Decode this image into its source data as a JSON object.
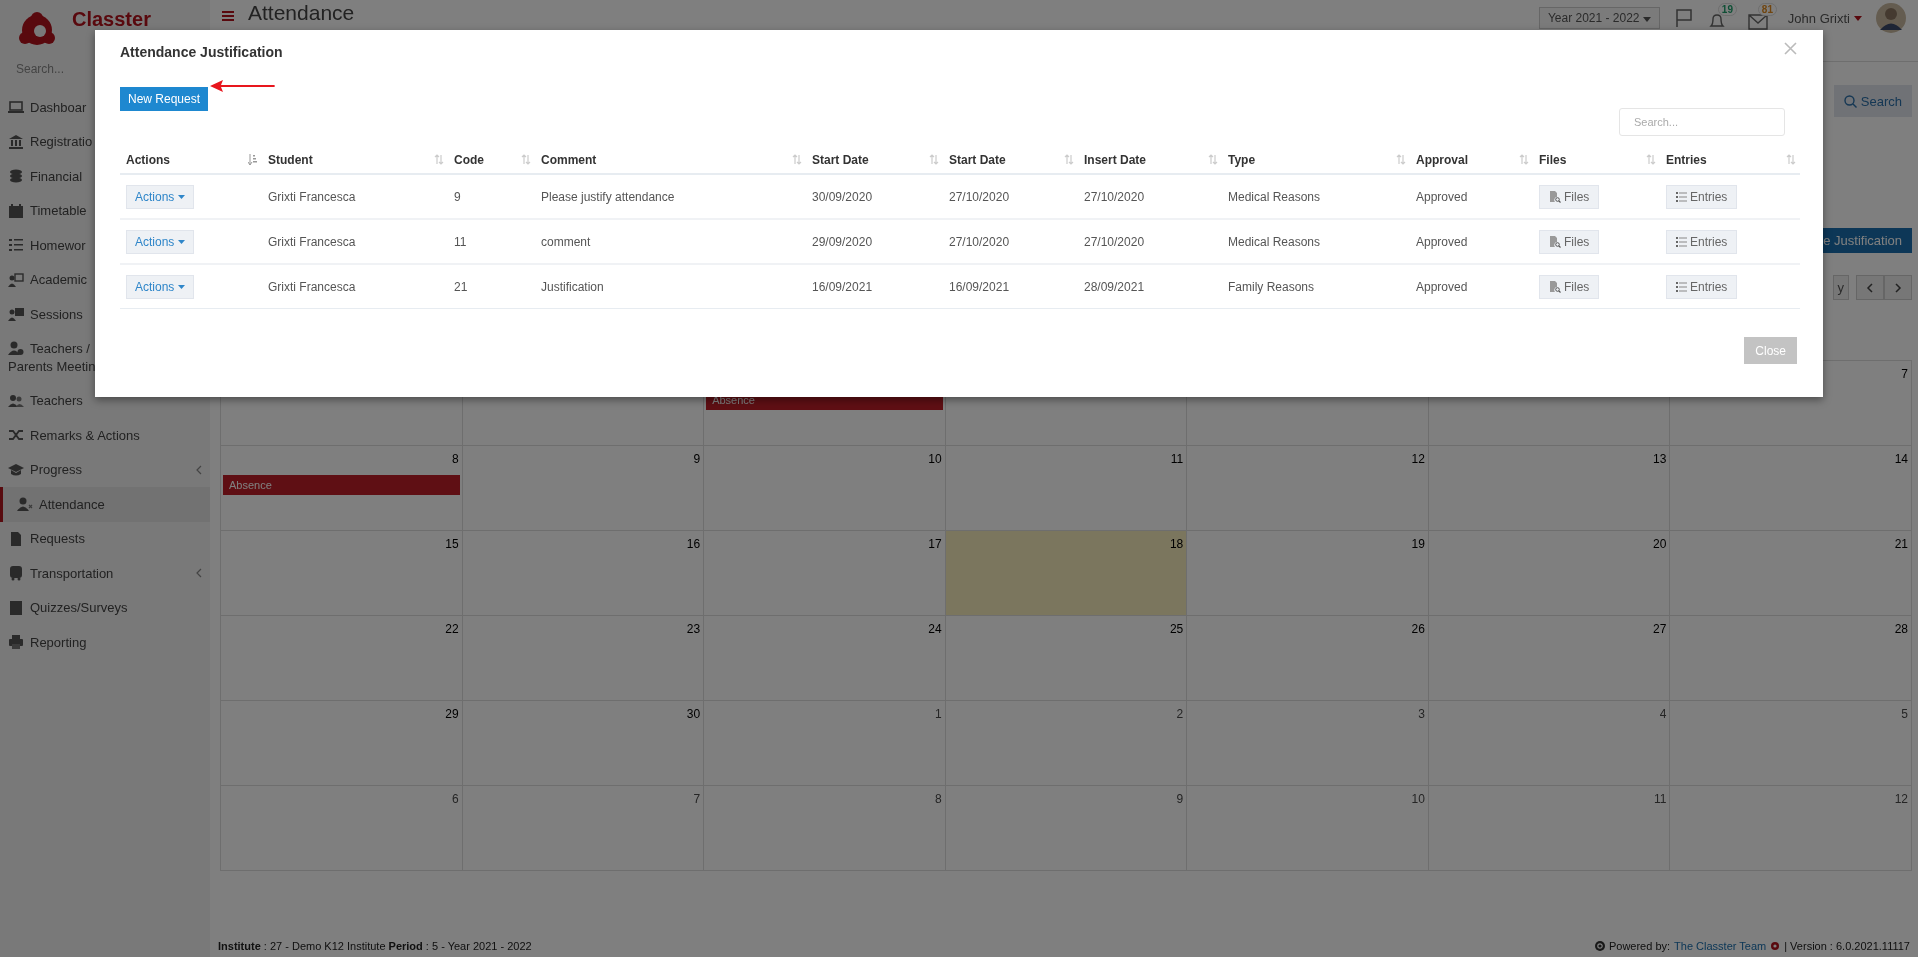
{
  "sidebar": {
    "logo": "Classter",
    "search_placeholder": "Search...",
    "items": [
      {
        "label": "Dashboar",
        "selected": false
      },
      {
        "label": "Registratio",
        "selected": false
      },
      {
        "label": "Financial",
        "selected": false
      },
      {
        "label": "Timetable",
        "selected": false
      },
      {
        "label": "Homewor",
        "selected": false
      },
      {
        "label": "Academic",
        "selected": false
      },
      {
        "label": "Sessions",
        "selected": false
      },
      {
        "label": "Teachers /\nParents Meetin",
        "selected": false
      },
      {
        "label": "Teachers",
        "selected": false,
        "submenu": false
      },
      {
        "label": "Remarks & Actions",
        "selected": false,
        "submenu": false
      },
      {
        "label": "Progress",
        "selected": false,
        "submenu": true
      },
      {
        "label": "Attendance",
        "selected": true,
        "submenu": false
      },
      {
        "label": "Requests",
        "selected": false,
        "submenu": false
      },
      {
        "label": "Transportation",
        "selected": false,
        "submenu": true
      },
      {
        "label": "Quizzes/Surveys",
        "selected": false,
        "submenu": false
      },
      {
        "label": "Reporting",
        "selected": false,
        "submenu": false
      }
    ]
  },
  "header": {
    "title": "Attendance",
    "year": "Year 2021 - 2022",
    "notifications": "19",
    "messages": "81",
    "user": "John Grixti"
  },
  "filters": {
    "search_button": "Search"
  },
  "toolbar": {
    "justification_button": "e Justification",
    "today_button": "y"
  },
  "calendar": {
    "weeks": [
      [
        {
          "today": false
        },
        {
          "today": false
        },
        {
          "today": false,
          "events": [
            "Absence"
          ]
        },
        {
          "today": false
        },
        {
          "today": false
        },
        {
          "today": false
        },
        {
          "number": "7",
          "muted": false,
          "today": false
        }
      ],
      [
        {
          "number": "8",
          "muted": false,
          "today": false,
          "events": [
            "Absence"
          ]
        },
        {
          "number": "9",
          "muted": false,
          "today": false
        },
        {
          "number": "10",
          "muted": false,
          "today": false
        },
        {
          "number": "11",
          "muted": false,
          "today": false
        },
        {
          "number": "12",
          "muted": false,
          "today": false
        },
        {
          "number": "13",
          "muted": false,
          "today": false
        },
        {
          "number": "14",
          "muted": false,
          "today": false
        }
      ],
      [
        {
          "number": "15",
          "muted": false,
          "today": false
        },
        {
          "number": "16",
          "muted": false,
          "today": false
        },
        {
          "number": "17",
          "muted": false,
          "today": false
        },
        {
          "number": "18",
          "muted": false,
          "today": true
        },
        {
          "number": "19",
          "muted": false,
          "today": false
        },
        {
          "number": "20",
          "muted": false,
          "today": false
        },
        {
          "number": "21",
          "muted": false,
          "today": false
        }
      ],
      [
        {
          "number": "22",
          "muted": false,
          "today": false
        },
        {
          "number": "23",
          "muted": false,
          "today": false
        },
        {
          "number": "24",
          "muted": false,
          "today": false
        },
        {
          "number": "25",
          "muted": false,
          "today": false
        },
        {
          "number": "26",
          "muted": false,
          "today": false
        },
        {
          "number": "27",
          "muted": false,
          "today": false
        },
        {
          "number": "28",
          "muted": false,
          "today": false
        }
      ],
      [
        {
          "number": "29",
          "muted": false,
          "today": false
        },
        {
          "number": "30",
          "muted": false,
          "today": false
        },
        {
          "number": "1",
          "muted": true,
          "today": false
        },
        {
          "number": "2",
          "muted": true,
          "today": false
        },
        {
          "number": "3",
          "muted": true,
          "today": false
        },
        {
          "number": "4",
          "muted": true,
          "today": false
        },
        {
          "number": "5",
          "muted": true,
          "today": false
        }
      ],
      [
        {
          "number": "6",
          "muted": true,
          "today": false
        },
        {
          "number": "7",
          "muted": true,
          "today": false
        },
        {
          "number": "8",
          "muted": true,
          "today": false
        },
        {
          "number": "9",
          "muted": true,
          "today": false
        },
        {
          "number": "10",
          "muted": true,
          "today": false
        },
        {
          "number": "11",
          "muted": true,
          "today": false
        },
        {
          "number": "12",
          "muted": true,
          "today": false
        }
      ]
    ]
  },
  "footer": {
    "info": "**Institute** : 27 - Demo K12 Institute **Period** : 5 - Year 2021 - 2022",
    "powered_by": "Powered by:",
    "team_link": "The Classter Team",
    "version": "| Version : 6.0.2021.11117"
  },
  "modal": {
    "title": "Attendance Justification",
    "new_request_button": "New Request",
    "search_placeholder": "Search...",
    "columns": [
      {
        "label": "Actions",
        "kind": "dropdown",
        "sorted": true
      },
      {
        "label": "Student",
        "kind": "text",
        "sorted": false
      },
      {
        "label": "Code",
        "kind": "text",
        "sorted": false
      },
      {
        "label": "Comment",
        "kind": "text",
        "sorted": false
      },
      {
        "label": "Start Date",
        "kind": "text",
        "sorted": false
      },
      {
        "label": "Start Date",
        "kind": "text",
        "sorted": false
      },
      {
        "label": "Insert Date",
        "kind": "text",
        "sorted": false
      },
      {
        "label": "Type",
        "kind": "text",
        "sorted": false
      },
      {
        "label": "Approval",
        "kind": "text",
        "sorted": false
      },
      {
        "label": "Files",
        "kind": "files",
        "sorted": false
      },
      {
        "label": "Entries",
        "kind": "entries",
        "sorted": false
      }
    ],
    "rows": [
      {
        "cells": [
          "Actions",
          "Grixti Francesca",
          "9",
          "Please justify attendance",
          "30/09/2020",
          "27/10/2020",
          "27/10/2020",
          "Medical Reasons",
          "Approved",
          "Files",
          "Entries"
        ]
      },
      {
        "cells": [
          "Actions",
          "Grixti Francesca",
          "11",
          "comment",
          "29/09/2020",
          "27/10/2020",
          "27/10/2020",
          "Medical Reasons",
          "Approved",
          "Files",
          "Entries"
        ]
      },
      {
        "cells": [
          "Actions",
          "Grixti Francesca",
          "21",
          "Justification",
          "16/09/2021",
          "16/09/2021",
          "28/09/2021",
          "Family Reasons",
          "Approved",
          "Files",
          "Entries"
        ]
      }
    ],
    "close_button": "Close"
  }
}
